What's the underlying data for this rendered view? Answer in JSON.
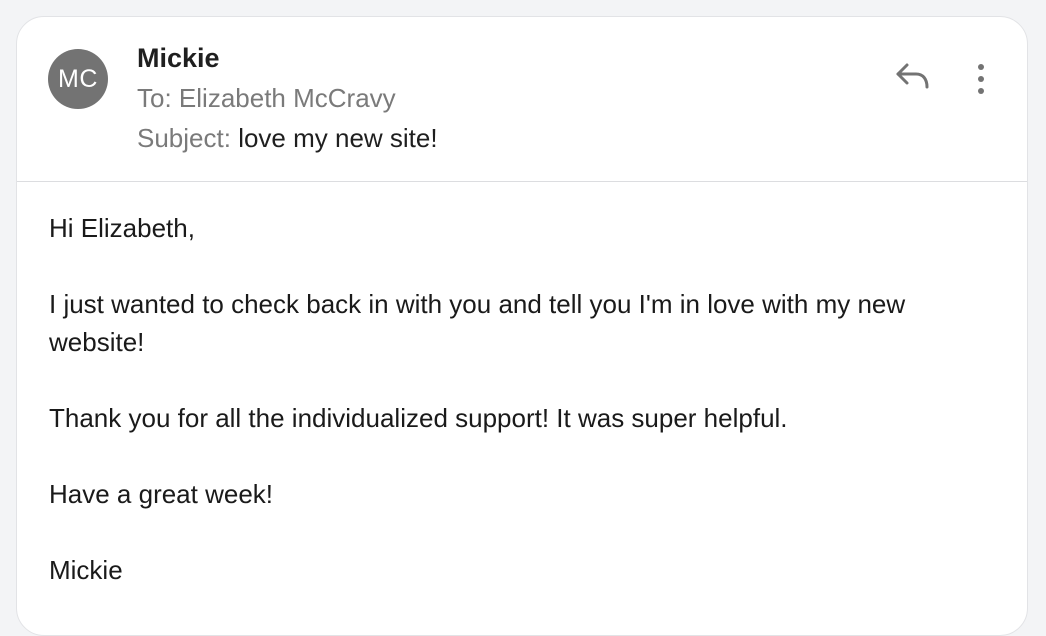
{
  "message": {
    "sender": {
      "initials": "MC",
      "name": "Mickie"
    },
    "to": {
      "label": "To:",
      "value": "Elizabeth McCravy"
    },
    "subject": {
      "label": "Subject:",
      "value": "love my new site!"
    },
    "actions": {
      "reply_icon": "reply-arrow",
      "more_icon": "vertical-ellipsis"
    },
    "body": {
      "greeting": "Hi Elizabeth,",
      "paragraph_1": "I just wanted to check back in with you and tell you I'm in love with my new website!",
      "paragraph_2": "Thank you for all the individualized support! It was super helpful.",
      "paragraph_3": "Have a great week!",
      "signature": "Mickie"
    }
  },
  "colors": {
    "avatar_bg": "#737373",
    "muted_text": "#7a7a7a",
    "body_text": "#1a1a1a",
    "icon_color": "#737373"
  }
}
